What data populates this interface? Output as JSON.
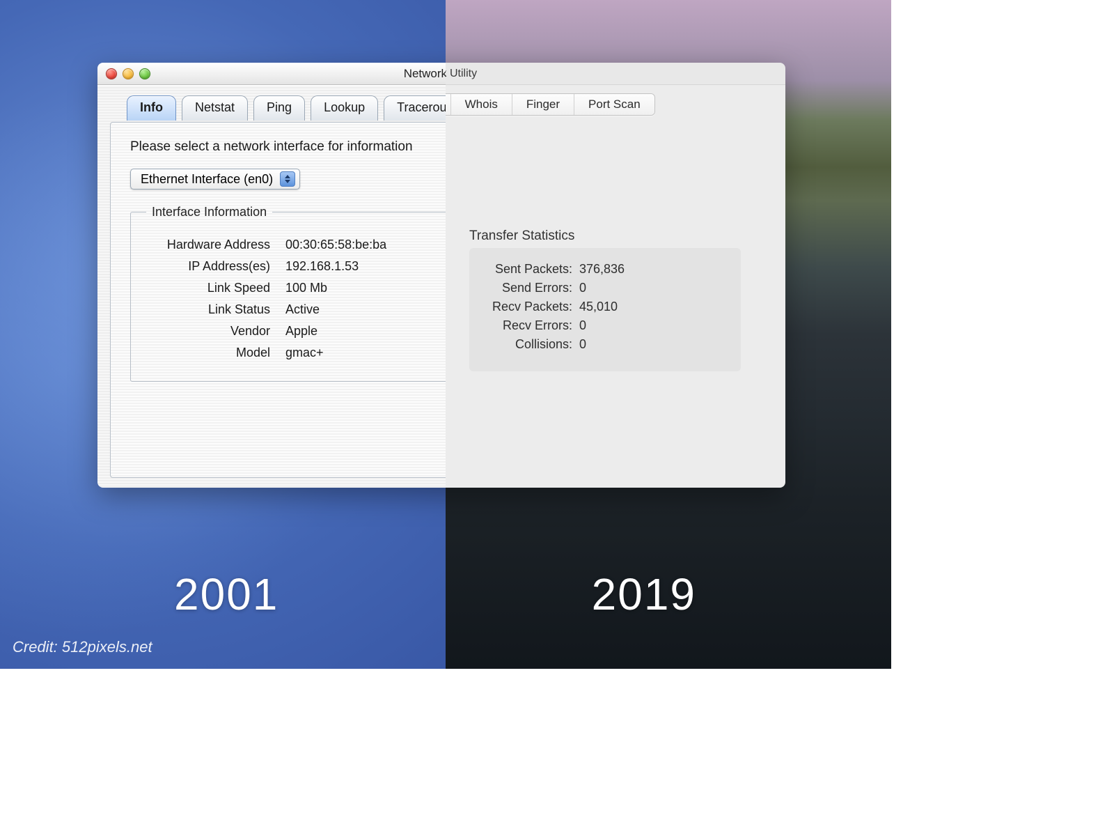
{
  "window_title": "Network Utility",
  "tabs": [
    "Info",
    "Netstat",
    "Ping",
    "Lookup",
    "Traceroute",
    "Whois",
    "Finger",
    "Port Scan"
  ],
  "active_tab_index": 0,
  "prompt": "Please select a network interface for information",
  "interface_popup": "Ethernet Interface (en0)",
  "fieldset_title": "Interface Information",
  "info": {
    "hardware_address": {
      "label": "Hardware Address",
      "value": "00:30:65:58:be:ba"
    },
    "ip_addresses": {
      "label": "IP Address(es)",
      "value": "192.168.1.53"
    },
    "link_speed": {
      "label": "Link Speed",
      "value": "100 Mb"
    },
    "link_status": {
      "label": "Link Status",
      "value": "Active"
    },
    "vendor": {
      "label": "Vendor",
      "value": "Apple"
    },
    "model": {
      "label": "Model",
      "value": "gmac+"
    }
  },
  "stats_title": "Transfer Statistics",
  "stats": {
    "sent_packets": {
      "label": "Sent Packets:",
      "value": "376,836"
    },
    "send_errors": {
      "label": "Send Errors:",
      "value": "0"
    },
    "recv_packets": {
      "label": "Recv Packets:",
      "value": "45,010"
    },
    "recv_errors": {
      "label": "Recv Errors:",
      "value": "0"
    },
    "collisions": {
      "label": "Collisions:",
      "value": "0"
    }
  },
  "years": {
    "left": "2001",
    "right": "2019"
  },
  "credit": "Credit: 512pixels.net"
}
